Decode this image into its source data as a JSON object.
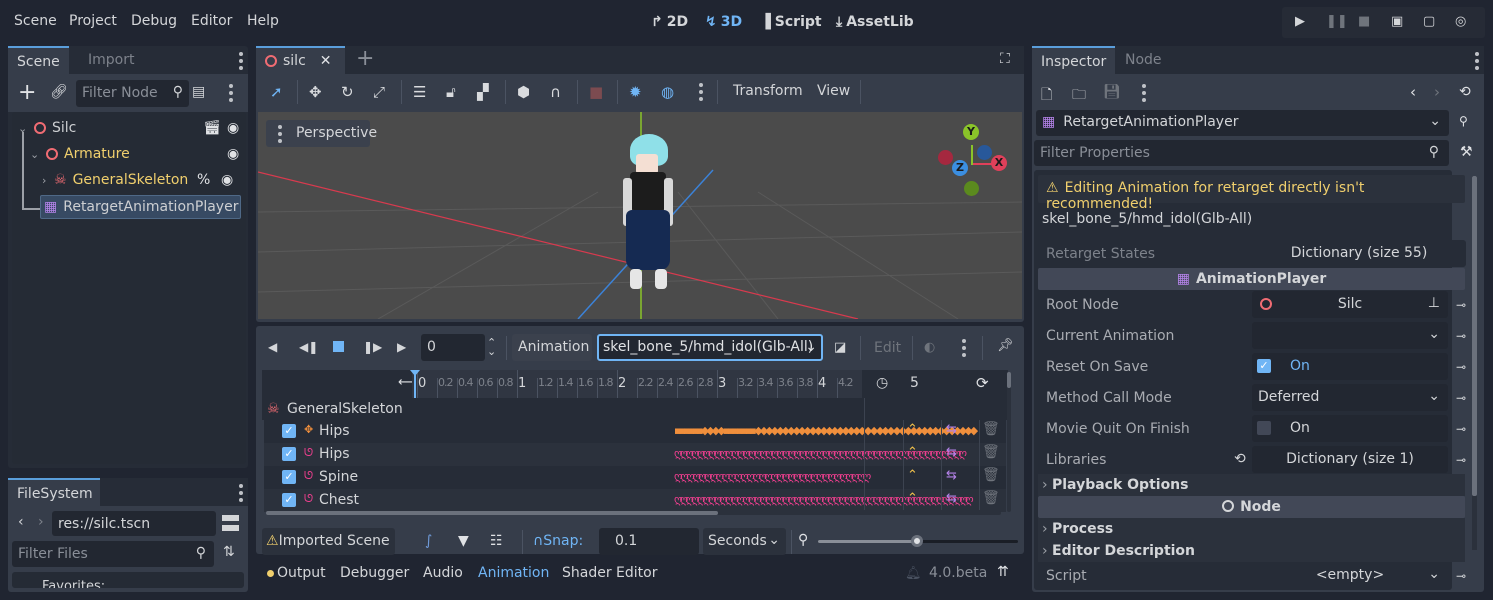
{
  "menu": [
    "Scene",
    "Project",
    "Debug",
    "Editor",
    "Help"
  ],
  "modes": [
    {
      "label": "2D",
      "icon": "2d-icon",
      "active": false
    },
    {
      "label": "3D",
      "icon": "3d-icon",
      "active": true
    },
    {
      "label": "Script",
      "icon": "script-icon",
      "active": false
    },
    {
      "label": "AssetLib",
      "icon": "assetlib-icon",
      "active": false
    }
  ],
  "scene_dock": {
    "tabs": [
      "Scene",
      "Import"
    ],
    "filter_placeholder": "Filter Node",
    "tree": [
      {
        "name": "Silc",
        "color": "#d4d6d9"
      },
      {
        "name": "Armature",
        "color": "#f0cf6d"
      },
      {
        "name": "GeneralSkeleton",
        "color": "#f0cf6d",
        "badge": "%"
      },
      {
        "name": "RetargetAnimationPlayer",
        "color": "#d4d6d9",
        "selected": true
      }
    ]
  },
  "filesystem": {
    "tab": "FileSystem",
    "path": "res://silc.tscn",
    "filter_placeholder": "Filter Files",
    "first_item": "Favorites:"
  },
  "editor": {
    "scene_tab": "silc",
    "viewport_label": "Perspective",
    "toolbar_menus": [
      "Transform",
      "View"
    ],
    "gizmo_axes": [
      "Y",
      "X",
      "Z"
    ]
  },
  "animation": {
    "time_value": "0",
    "animation_label": "Animation",
    "current_animation": "skel_bone_5/hmd_idol(Glb-All)",
    "edit_label": "Edit",
    "timeline_ticks": [
      "0",
      "0.2",
      "0.4",
      "0.6",
      "0.8",
      "1",
      "1.2",
      "1.4",
      "1.6",
      "1.8",
      "2",
      "2.2",
      "2.4",
      "2.6",
      "2.8",
      "3",
      "3.2",
      "3.4",
      "3.6",
      "3.8",
      "4",
      "4.2"
    ],
    "length": "5",
    "track_group": "GeneralSkeleton",
    "tracks": [
      {
        "name": "Hips",
        "type": "position",
        "color": "#f08f3c",
        "checked": true
      },
      {
        "name": "Hips",
        "type": "rotation",
        "color": "#ef3f8f",
        "checked": true
      },
      {
        "name": "Spine",
        "type": "rotation",
        "color": "#ef3f8f",
        "checked": true
      },
      {
        "name": "Chest",
        "type": "rotation",
        "color": "#ef3f8f",
        "checked": true
      }
    ],
    "imported_scene_label": "Imported Scene",
    "snap_label": "Snap:",
    "snap_value": "0.1",
    "snap_unit": "Seconds",
    "zoom_level": 0.6
  },
  "bottom_tabs": [
    "Output",
    "Debugger",
    "Audio",
    "Animation",
    "Shader Editor"
  ],
  "active_bottom_tab": "Animation",
  "version": "4.0.beta",
  "inspector": {
    "tabs": [
      "Inspector",
      "Node"
    ],
    "object": "RetargetAnimationPlayer",
    "filter_placeholder": "Filter Properties",
    "warning": "Editing Animation for retarget directly isn't recommended!",
    "resource_name": "skel_bone_5/hmd_idol(Glb-All)",
    "retarget_states_label": "Retarget States",
    "retarget_states_value": "Dictionary (size 55)",
    "section_animplayer": "AnimationPlayer",
    "root_node_label": "Root Node",
    "root_node_value": "Silc",
    "current_anim_label": "Current Animation",
    "current_anim_value": "",
    "reset_on_save_label": "Reset On Save",
    "reset_on_save_value": "On",
    "method_call_label": "Method Call Mode",
    "method_call_value": "Deferred",
    "movie_quit_label": "Movie Quit On Finish",
    "movie_quit_value": "On",
    "libraries_label": "Libraries",
    "libraries_value": "Dictionary (size 1)",
    "group_playback": "Playback Options",
    "section_node": "Node",
    "group_process": "Process",
    "group_editor_desc": "Editor Description",
    "script_label": "Script",
    "script_value": "<empty>"
  }
}
